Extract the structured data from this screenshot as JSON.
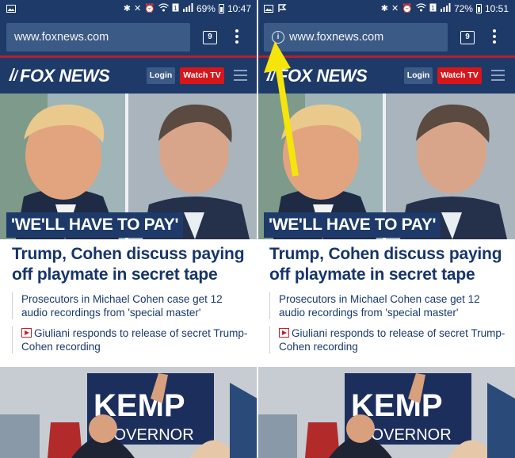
{
  "left": {
    "status": {
      "battery_percent": "69%",
      "time": "10:47",
      "notification_icons": [
        "image-icon"
      ]
    },
    "browser": {
      "url": "www.foxnews.com",
      "tab_count": "9",
      "show_info_icon": false
    }
  },
  "right": {
    "status": {
      "battery_percent": "72%",
      "time": "10:51",
      "notification_icons": [
        "image-icon",
        "flag-icon"
      ]
    },
    "browser": {
      "url": "www.foxnews.com",
      "tab_count": "9",
      "show_info_icon": true
    }
  },
  "site": {
    "logo_text": "FOX NEWS",
    "login_label": "Login",
    "watch_label": "Watch TV"
  },
  "story": {
    "banner": "'WE'LL HAVE TO PAY'",
    "headline": "Trump, Cohen discuss paying off playmate in secret tape",
    "related": [
      {
        "text": "Prosecutors in Michael Cohen case get 12 audio recordings from 'special master'",
        "has_video_icon": false
      },
      {
        "text": "Giuliani responds to release of secret Trump-Cohen recording",
        "has_video_icon": true
      }
    ]
  },
  "second_story": {
    "sign_text_line1": "KEMP",
    "sign_text_line2": "GOVERNOR"
  },
  "annotation": {
    "arrow_color": "#f5e50a",
    "points_to": "info-icon"
  },
  "colors": {
    "fox_navy": "#1d3a69",
    "url_box": "#3c5a86",
    "watch_red": "#d7161b",
    "headline_blue": "#16356a"
  }
}
